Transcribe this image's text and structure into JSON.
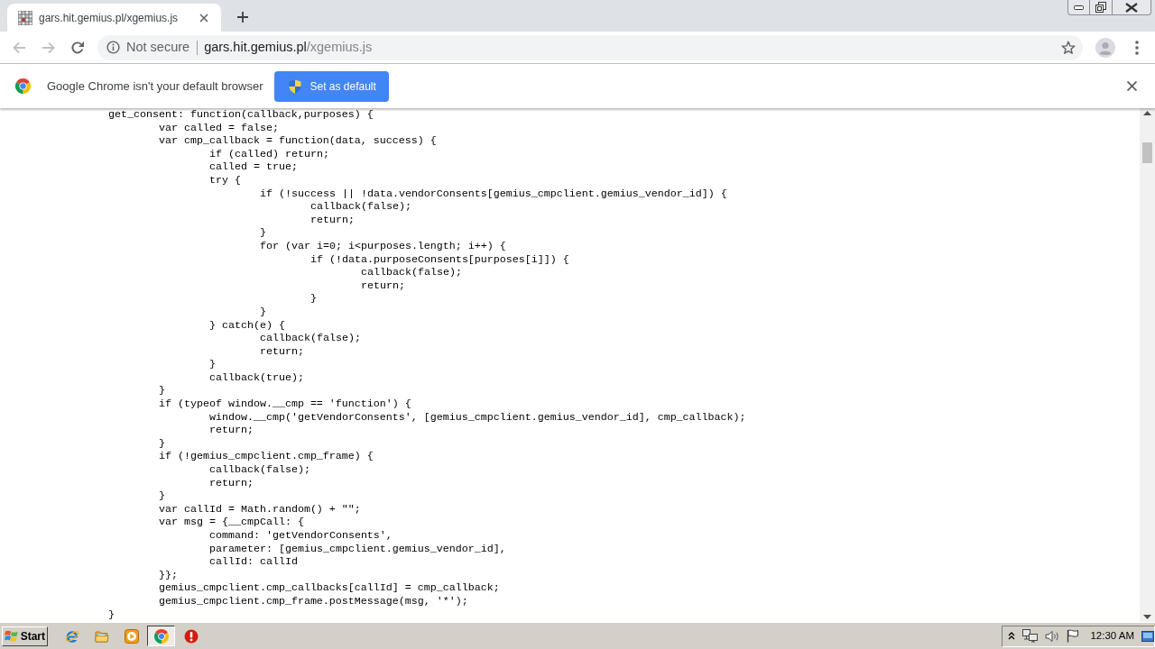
{
  "tabs": [
    {
      "title": "gars.hit.gemius.pl/xgemius.js",
      "selected": true
    }
  ],
  "toolbar": {
    "back": {
      "disabled": true
    },
    "forward": {
      "disabled": true
    },
    "security_label": "Not secure",
    "url": {
      "host": "gars.hit.gemius.pl",
      "path": "/xgemius.js"
    }
  },
  "infobar": {
    "message": "Google Chrome isn't your default browser",
    "button": "Set as default"
  },
  "code_lines": [
    {
      "text": "get_consent: function(callback,purposes) {",
      "children": [
        {
          "text": "var called = false;"
        },
        {
          "text": "var cmp_callback = function(data, success) {",
          "children": [
            {
              "text": "if (called) return;"
            },
            {
              "text": "called = true;"
            },
            {
              "text": "try {",
              "children": [
                {
                  "text": "if (!success || !data.vendorConsents[gemius_cmpclient.gemius_vendor_id]) {",
                  "children": [
                    {
                      "text": "callback(false);"
                    },
                    {
                      "text": "return;"
                    }
                  ]
                },
                {
                  "text": "}"
                },
                {
                  "text": "for (var i=0; i<purposes.length; i++) {",
                  "children": [
                    {
                      "text": "if (!data.purposeConsents[purposes[i]]) {",
                      "children": [
                        {
                          "text": "callback(false);"
                        },
                        {
                          "text": "return;"
                        }
                      ]
                    },
                    {
                      "text": "}"
                    }
                  ]
                },
                {
                  "text": "}"
                }
              ]
            },
            {
              "text": "} catch(e) {",
              "children": [
                {
                  "text": "callback(false);"
                },
                {
                  "text": "return;"
                }
              ]
            },
            {
              "text": "}"
            },
            {
              "text": "callback(true);"
            }
          ]
        },
        {
          "text": "}"
        },
        {
          "text": "if (typeof window.__cmp == 'function') {",
          "children": [
            {
              "text": "window.__cmp('getVendorConsents', [gemius_cmpclient.gemius_vendor_id], cmp_callback);"
            },
            {
              "text": "return;"
            }
          ]
        },
        {
          "text": "}"
        },
        {
          "text": "if (!gemius_cmpclient.cmp_frame) {",
          "children": [
            {
              "text": "callback(false);"
            },
            {
              "text": "return;"
            }
          ]
        },
        {
          "text": "}"
        },
        {
          "text": "var callId = Math.random() + \"\";"
        },
        {
          "text": "var msg = {__cmpCall: {",
          "children": [
            {
              "text": "command: 'getVendorConsents',"
            },
            {
              "text": "parameter: [gemius_cmpclient.gemius_vendor_id],"
            },
            {
              "text": "callId: callId"
            }
          ]
        },
        {
          "text": "}};"
        },
        {
          "text": "gemius_cmpclient.cmp_callbacks[callId] = cmp_callback;"
        },
        {
          "text": "gemius_cmpclient.cmp_frame.postMessage(msg, '*');"
        }
      ]
    },
    {
      "text": "}"
    }
  ],
  "taskbar": {
    "start": "Start",
    "apps": [
      {
        "kind": "browser",
        "selected": false
      },
      {
        "kind": "folder",
        "selected": false
      },
      {
        "kind": "player",
        "selected": false
      },
      {
        "kind": "webbrowser",
        "selected": true
      },
      {
        "kind": "alert",
        "selected": false
      }
    ],
    "clock": "12:30 AM"
  }
}
